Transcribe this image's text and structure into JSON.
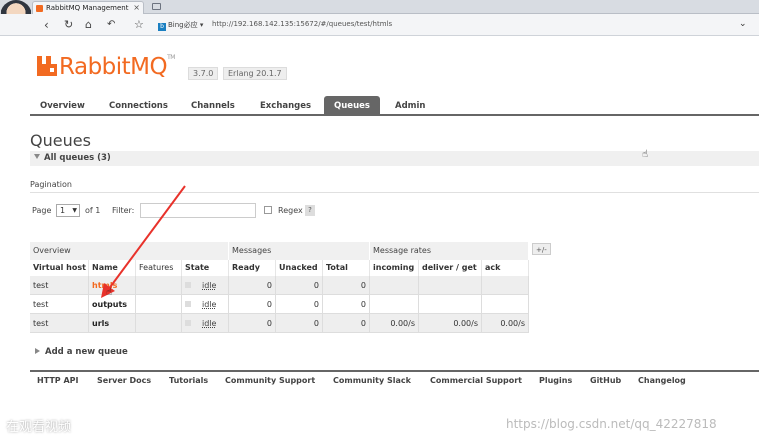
{
  "browser": {
    "tab_title": "RabbitMQ Management",
    "search_engine": "Bing必应",
    "url": "http://192.168.142.135:15672/#/queues/test/htmls"
  },
  "header": {
    "brand": "RabbitMQ",
    "trademark": "TM",
    "version": "3.7.0",
    "erlang": "Erlang 20.1.7"
  },
  "nav": {
    "tabs": [
      {
        "label": "Overview"
      },
      {
        "label": "Connections"
      },
      {
        "label": "Channels"
      },
      {
        "label": "Exchanges"
      },
      {
        "label": "Queues",
        "active": true
      },
      {
        "label": "Admin"
      }
    ]
  },
  "page": {
    "title": "Queues",
    "section": "All queues (3)",
    "pagination_label": "Pagination",
    "page_label": "Page",
    "page_value": "1",
    "of_label": "of 1",
    "filter_label": "Filter:",
    "regex_label": "Regex",
    "regex_help": "?",
    "add_queue": "Add a new queue",
    "plus_minus": "+/-"
  },
  "table": {
    "groups": [
      "Overview",
      "Messages",
      "Message rates"
    ],
    "columns": [
      "Virtual host",
      "Name",
      "Features",
      "State",
      "Ready",
      "Unacked",
      "Total",
      "incoming",
      "deliver / get",
      "ack"
    ],
    "rows": [
      {
        "vhost": "test",
        "name": "htmls",
        "features": "",
        "state": "idle",
        "ready": "0",
        "unacked": "0",
        "total": "0",
        "incoming": "",
        "deliver": "",
        "ack": ""
      },
      {
        "vhost": "test",
        "name": "outputs",
        "features": "",
        "state": "idle",
        "ready": "0",
        "unacked": "0",
        "total": "0",
        "incoming": "",
        "deliver": "",
        "ack": ""
      },
      {
        "vhost": "test",
        "name": "urls",
        "features": "",
        "state": "idle",
        "ready": "0",
        "unacked": "0",
        "total": "0",
        "incoming": "0.00/s",
        "deliver": "0.00/s",
        "ack": "0.00/s"
      }
    ]
  },
  "footer": {
    "links": [
      "HTTP API",
      "Server Docs",
      "Tutorials",
      "Community Support",
      "Community Slack",
      "Commercial Support",
      "Plugins",
      "GitHub",
      "Changelog"
    ]
  },
  "overlay": {
    "watermark_left": "在观看视频",
    "watermark_right": "https://blog.csdn.net/qq_42227818"
  },
  "colors": {
    "brand": "#f26a21",
    "tab_active": "#666666",
    "annotation_arrow": "#e8322b"
  }
}
